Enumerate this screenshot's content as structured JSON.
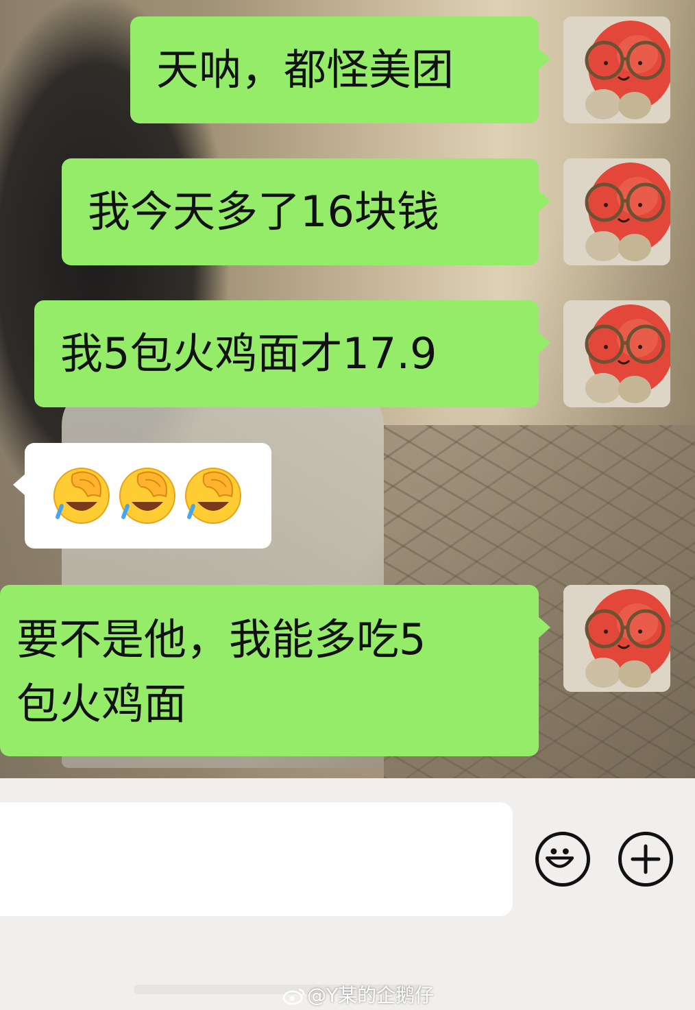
{
  "chat": {
    "messages": [
      {
        "direction": "outgoing",
        "text": "天呐，都怪美团"
      },
      {
        "direction": "outgoing",
        "text": "我今天多了16块钱"
      },
      {
        "direction": "outgoing",
        "text": "我5包火鸡面才17.9"
      },
      {
        "direction": "incoming",
        "emojis": [
          "face-palm-crying-emoji",
          "face-palm-crying-emoji",
          "face-palm-crying-emoji"
        ]
      },
      {
        "direction": "outgoing",
        "line1": "要不是他，我能多吃5",
        "line2": "包火鸡面"
      }
    ],
    "avatar_icon": "tomato-plush-avatar",
    "colors": {
      "outgoing_bubble": "#95ec69",
      "incoming_bubble": "#ffffff"
    }
  },
  "input_bar": {
    "text_value": "",
    "emoji_button_icon": "smiley-face-icon",
    "more_button_icon": "plus-circle-icon"
  },
  "watermark": {
    "text": "@Y某的企鹅仔"
  }
}
